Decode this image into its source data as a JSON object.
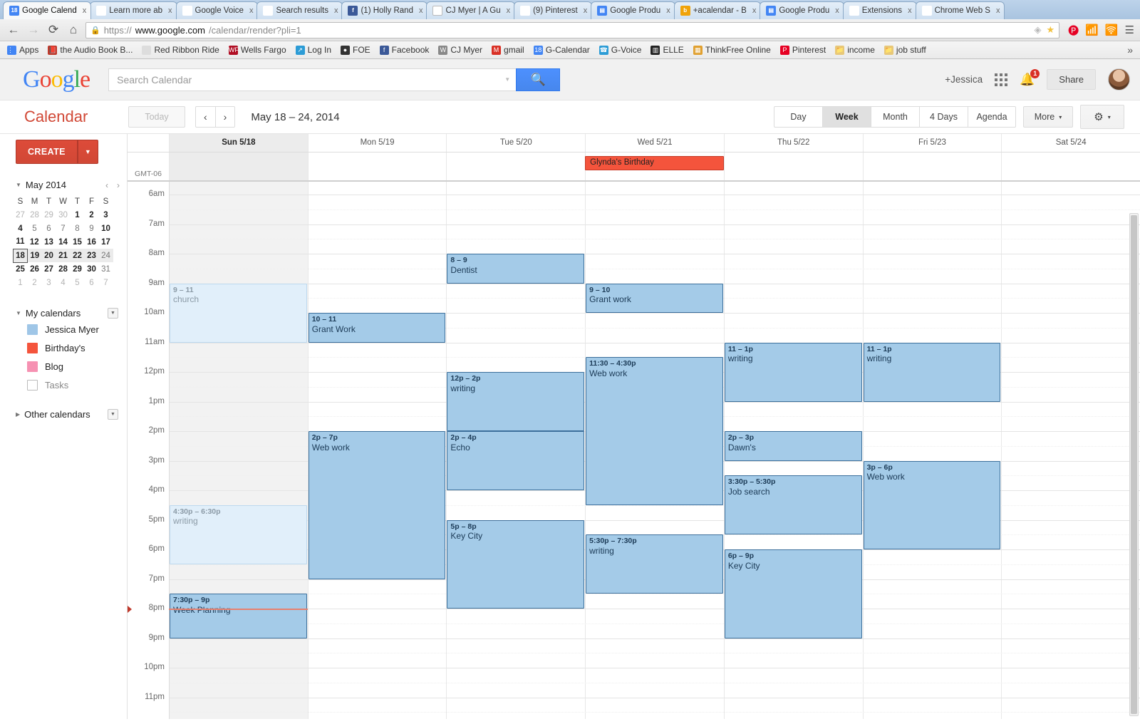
{
  "browser": {
    "tabs": [
      {
        "title": "Google Calend",
        "favicon": "gcal-favicon",
        "active": true
      },
      {
        "title": "Learn more ab",
        "favicon": "google-favicon",
        "active": false
      },
      {
        "title": "Google Voice",
        "favicon": "gvoice-favicon",
        "active": false
      },
      {
        "title": "Search results",
        "favicon": "gmail-favicon",
        "active": false
      },
      {
        "title": "(1) Holly Rand",
        "favicon": "facebook-favicon",
        "active": false
      },
      {
        "title": "CJ Myer | A Gu",
        "favicon": "wordpress-favicon",
        "active": false
      },
      {
        "title": "(9) Pinterest",
        "favicon": "pinterest-favicon",
        "active": false
      },
      {
        "title": "Google Produ",
        "favicon": "google-product-favicon",
        "active": false
      },
      {
        "title": "+acalendar - B",
        "favicon": "bing-favicon",
        "active": false
      },
      {
        "title": "Google Produ",
        "favicon": "google-product-favicon",
        "active": false
      },
      {
        "title": "Extensions",
        "favicon": "extensions-favicon",
        "active": false
      },
      {
        "title": "Chrome Web S",
        "favicon": "chrome-web-store-favicon",
        "active": false
      }
    ],
    "tab_close_label": "x",
    "url": {
      "scheme": "https://",
      "domain": "www.google.com",
      "path": "/calendar/render?pli=1"
    },
    "omni_icons": [
      "view-icon",
      "bookmark-star-icon",
      "pinterest-ext-icon",
      "rss-ext-icon",
      "broadcast-ext-icon",
      "menu-icon"
    ],
    "bookmarks": [
      {
        "label": "Apps",
        "icon": "apps-grid-icon"
      },
      {
        "label": "the Audio Book B...",
        "icon": "audiobook-icon"
      },
      {
        "label": "Red Ribbon Ride",
        "icon": "page-icon"
      },
      {
        "label": "Wells Fargo",
        "icon": "wellsfargo-icon"
      },
      {
        "label": "Log In",
        "icon": "login-icon"
      },
      {
        "label": "FOE",
        "icon": "foe-icon"
      },
      {
        "label": "Facebook",
        "icon": "facebook-icon"
      },
      {
        "label": "CJ Myer",
        "icon": "wordpress-icon"
      },
      {
        "label": "gmail",
        "icon": "gmail-icon"
      },
      {
        "label": "G-Calendar",
        "icon": "gcal-icon"
      },
      {
        "label": "G-Voice",
        "icon": "gvoice-icon"
      },
      {
        "label": "ELLE",
        "icon": "elle-icon"
      },
      {
        "label": "ThinkFree Online",
        "icon": "thinkfree-icon"
      },
      {
        "label": "Pinterest",
        "icon": "pinterest-icon"
      },
      {
        "label": "income",
        "icon": "folder-icon"
      },
      {
        "label": "job stuff",
        "icon": "folder-icon"
      }
    ],
    "bookmarks_overflow": "»"
  },
  "header": {
    "logo_letters": [
      "G",
      "o",
      "o",
      "g",
      "l",
      "e"
    ],
    "search": {
      "placeholder": "Search Calendar",
      "value": "",
      "button_icon": "search-icon"
    },
    "account_name": "+Jessica",
    "apps_icon": "apps-grid-icon",
    "notification_icon": "bell-icon",
    "notification_count": "1",
    "share_label": "Share",
    "avatar": "user-avatar"
  },
  "toolbar": {
    "wordmark": "Calendar",
    "today_label": "Today",
    "prev_icon": "‹",
    "next_icon": "›",
    "date_range": "May 18 – 24, 2014",
    "views": [
      {
        "label": "Day",
        "selected": false
      },
      {
        "label": "Week",
        "selected": true
      },
      {
        "label": "Month",
        "selected": false
      },
      {
        "label": "4 Days",
        "selected": false
      },
      {
        "label": "Agenda",
        "selected": false
      }
    ],
    "more_label": "More",
    "more_caret": "▾",
    "settings_icon": "gear-icon",
    "settings_caret": "▾"
  },
  "sidebar": {
    "create_label": "CREATE",
    "create_caret": "▼",
    "mini_calendar": {
      "title": "May 2014",
      "prev": "‹",
      "next": "›",
      "weekday_headers": [
        "S",
        "M",
        "T",
        "W",
        "T",
        "F",
        "S"
      ],
      "weeks": [
        [
          {
            "d": "27",
            "k": "other"
          },
          {
            "d": "28",
            "k": "other"
          },
          {
            "d": "29",
            "k": "other"
          },
          {
            "d": "30",
            "k": "other"
          },
          {
            "d": "1",
            "k": "n"
          },
          {
            "d": "2",
            "k": "n"
          },
          {
            "d": "3",
            "k": "n"
          }
        ],
        [
          {
            "d": "4",
            "k": "n"
          },
          {
            "d": "5",
            "k": "dim"
          },
          {
            "d": "6",
            "k": "dim"
          },
          {
            "d": "7",
            "k": "dim"
          },
          {
            "d": "8",
            "k": "dim"
          },
          {
            "d": "9",
            "k": "dim"
          },
          {
            "d": "10",
            "k": "n"
          }
        ],
        [
          {
            "d": "11",
            "k": "n"
          },
          {
            "d": "12",
            "k": "n"
          },
          {
            "d": "13",
            "k": "n"
          },
          {
            "d": "14",
            "k": "n"
          },
          {
            "d": "15",
            "k": "n"
          },
          {
            "d": "16",
            "k": "n"
          },
          {
            "d": "17",
            "k": "n"
          }
        ],
        [
          {
            "d": "18",
            "k": "today"
          },
          {
            "d": "19",
            "k": "n"
          },
          {
            "d": "20",
            "k": "n"
          },
          {
            "d": "21",
            "k": "n"
          },
          {
            "d": "22",
            "k": "n"
          },
          {
            "d": "23",
            "k": "n"
          },
          {
            "d": "24",
            "k": "dim"
          }
        ],
        [
          {
            "d": "25",
            "k": "n"
          },
          {
            "d": "26",
            "k": "n"
          },
          {
            "d": "27",
            "k": "n"
          },
          {
            "d": "28",
            "k": "n"
          },
          {
            "d": "29",
            "k": "n"
          },
          {
            "d": "30",
            "k": "n"
          },
          {
            "d": "31",
            "k": "dim"
          }
        ],
        [
          {
            "d": "1",
            "k": "other"
          },
          {
            "d": "2",
            "k": "other"
          },
          {
            "d": "3",
            "k": "other"
          },
          {
            "d": "4",
            "k": "other"
          },
          {
            "d": "5",
            "k": "other"
          },
          {
            "d": "6",
            "k": "other"
          },
          {
            "d": "7",
            "k": "other"
          }
        ]
      ],
      "selected_week_index": 3
    },
    "my_calendars": {
      "title": "My calendars",
      "collapse_caret": "▾",
      "dropdown_caret": "▾",
      "items": [
        {
          "label": "Jessica Myer",
          "color": "#9fc6e7",
          "checked": true
        },
        {
          "label": "Birthday's",
          "color": "#f4543c",
          "checked": true
        },
        {
          "label": "Blog",
          "color": "#f691b2",
          "checked": true
        },
        {
          "label": "Tasks",
          "color": "",
          "checked": false
        }
      ]
    },
    "other_calendars": {
      "title": "Other calendars",
      "expand_caret": "▸",
      "dropdown_caret": "▾"
    }
  },
  "grid": {
    "timezone_label": "GMT-06",
    "days": [
      {
        "label": "Sun 5/18",
        "today": true
      },
      {
        "label": "Mon 5/19",
        "today": false
      },
      {
        "label": "Tue 5/20",
        "today": false
      },
      {
        "label": "Wed 5/21",
        "today": false
      },
      {
        "label": "Thu 5/22",
        "today": false
      },
      {
        "label": "Fri 5/23",
        "today": false
      },
      {
        "label": "Sat 5/24",
        "today": false
      }
    ],
    "hours": [
      "6am",
      "7am",
      "8am",
      "9am",
      "10am",
      "11am",
      "12pm",
      "1pm",
      "2pm",
      "3pm",
      "4pm",
      "5pm",
      "6pm",
      "7pm",
      "8pm",
      "9pm",
      "10pm",
      "11pm"
    ],
    "all_day_events": [
      {
        "title": "Glynda's Birthday",
        "day": 3,
        "color": "#f4543c"
      }
    ],
    "events": [
      {
        "time": "9 – 11",
        "title": "church",
        "day": 0,
        "start": 9.0,
        "end": 11.0,
        "style": "faded"
      },
      {
        "time": "4:30p – 6:30p",
        "title": "writing",
        "day": 0,
        "start": 16.5,
        "end": 18.5,
        "style": "faded"
      },
      {
        "time": "7:30p – 9p",
        "title": "Week Planning",
        "day": 0,
        "start": 19.5,
        "end": 21.0,
        "style": "solid"
      },
      {
        "time": "10 – 11",
        "title": "Grant Work",
        "day": 1,
        "start": 10.0,
        "end": 11.0,
        "style": "solid"
      },
      {
        "time": "2p – 7p",
        "title": "Web work",
        "day": 1,
        "start": 14.0,
        "end": 19.0,
        "style": "solid"
      },
      {
        "time": "8 – 9",
        "title": "Dentist",
        "day": 2,
        "start": 8.0,
        "end": 9.0,
        "style": "solid"
      },
      {
        "time": "12p – 2p",
        "title": "writing",
        "day": 2,
        "start": 12.0,
        "end": 14.0,
        "style": "solid"
      },
      {
        "time": "2p – 4p",
        "title": "Echo",
        "day": 2,
        "start": 14.0,
        "end": 16.0,
        "style": "solid"
      },
      {
        "time": "5p – 8p",
        "title": "Key City",
        "day": 2,
        "start": 17.0,
        "end": 20.0,
        "style": "solid"
      },
      {
        "time": "9 – 10",
        "title": "Grant work",
        "day": 3,
        "start": 9.0,
        "end": 10.0,
        "style": "solid"
      },
      {
        "time": "11:30 – 4:30p",
        "title": "Web work",
        "day": 3,
        "start": 11.5,
        "end": 16.5,
        "style": "solid"
      },
      {
        "time": "5:30p – 7:30p",
        "title": "writing",
        "day": 3,
        "start": 17.5,
        "end": 19.5,
        "style": "solid"
      },
      {
        "time": "11 – 1p",
        "title": "writing",
        "day": 4,
        "start": 11.0,
        "end": 13.0,
        "style": "solid"
      },
      {
        "time": "2p – 3p",
        "title": "Dawn's",
        "day": 4,
        "start": 14.0,
        "end": 15.0,
        "style": "solid"
      },
      {
        "time": "3:30p – 5:30p",
        "title": "Job search",
        "day": 4,
        "start": 15.5,
        "end": 17.5,
        "style": "solid"
      },
      {
        "time": "6p – 9p",
        "title": "Key City",
        "day": 4,
        "start": 18.0,
        "end": 21.0,
        "style": "solid"
      },
      {
        "time": "11 – 1p",
        "title": "writing",
        "day": 5,
        "start": 11.0,
        "end": 13.0,
        "style": "solid"
      },
      {
        "time": "3p – 6p",
        "title": "Web work",
        "day": 5,
        "start": 15.0,
        "end": 18.0,
        "style": "solid"
      }
    ],
    "now_marker_hour": 20.0,
    "now_marker_day": 0
  }
}
